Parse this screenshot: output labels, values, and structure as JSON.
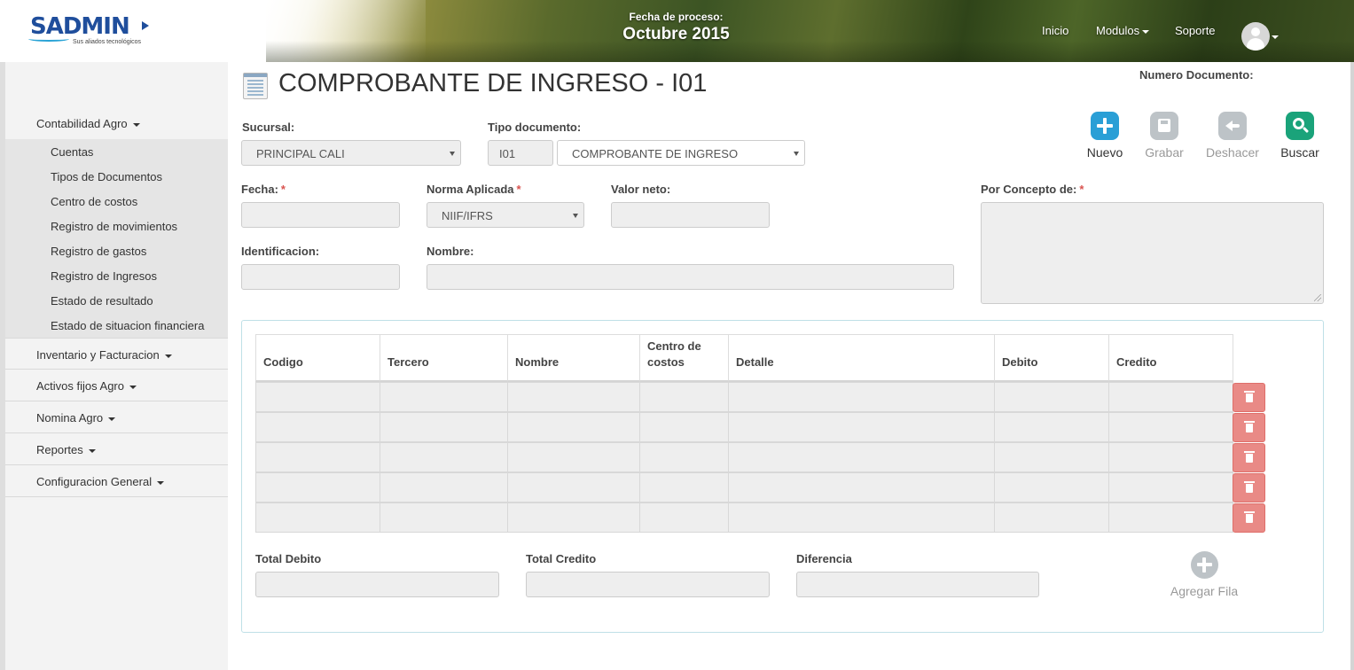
{
  "brand": {
    "logo_text": "SADMIN",
    "tagline": "Sus aliados tecnológicos"
  },
  "header": {
    "process_label": "Fecha de proceso:",
    "process_date": "Octubre 2015",
    "nav": {
      "inicio": "Inicio",
      "modulos": "Modulos",
      "soporte": "Soporte"
    }
  },
  "sidebar": {
    "groups": [
      "Contabilidad Agro",
      "Inventario y Facturacion",
      "Activos fijos Agro",
      "Nomina Agro",
      "Reportes",
      "Configuracion General"
    ],
    "sub_items": [
      "Cuentas",
      "Tipos de Documentos",
      "Centro de costos",
      "Registro de movimientos",
      "Registro de gastos",
      "Registro de Ingresos",
      "Estado de resultado",
      "Estado de situacion financiera"
    ]
  },
  "page": {
    "title": "COMPROBANTE DE INGRESO - I01",
    "numero_documento_label": "Numero Documento:"
  },
  "toolbar": {
    "nuevo": "Nuevo",
    "grabar": "Grabar",
    "deshacer": "Deshacer",
    "buscar": "Buscar",
    "colors": {
      "nuevo": "#2a9fd6",
      "disabled": "#bdc3c7",
      "buscar": "#1aa37a"
    }
  },
  "form": {
    "sucursal_label": "Sucursal:",
    "sucursal_value": "PRINCIPAL CALI",
    "tipo_documento_label": "Tipo documento:",
    "tipo_documento_code": "I01",
    "tipo_documento_value": "COMPROBANTE DE INGRESO",
    "fecha_label": "Fecha:",
    "norma_label": "Norma Aplicada",
    "norma_value": "NIIF/IFRS",
    "valor_neto_label": "Valor neto:",
    "concepto_label": "Por Concepto de:",
    "identificacion_label": "Identificacion:",
    "nombre_label": "Nombre:",
    "required_mark": "*"
  },
  "grid": {
    "headers": [
      "Codigo",
      "Tercero",
      "Nombre",
      "Centro de costos",
      "Detalle",
      "Debito",
      "Credito"
    ],
    "row_count": 5
  },
  "totals": {
    "debito_label": "Total Debito",
    "credito_label": "Total Credito",
    "diferencia_label": "Diferencia",
    "agregar_fila": "Agregar Fila"
  }
}
